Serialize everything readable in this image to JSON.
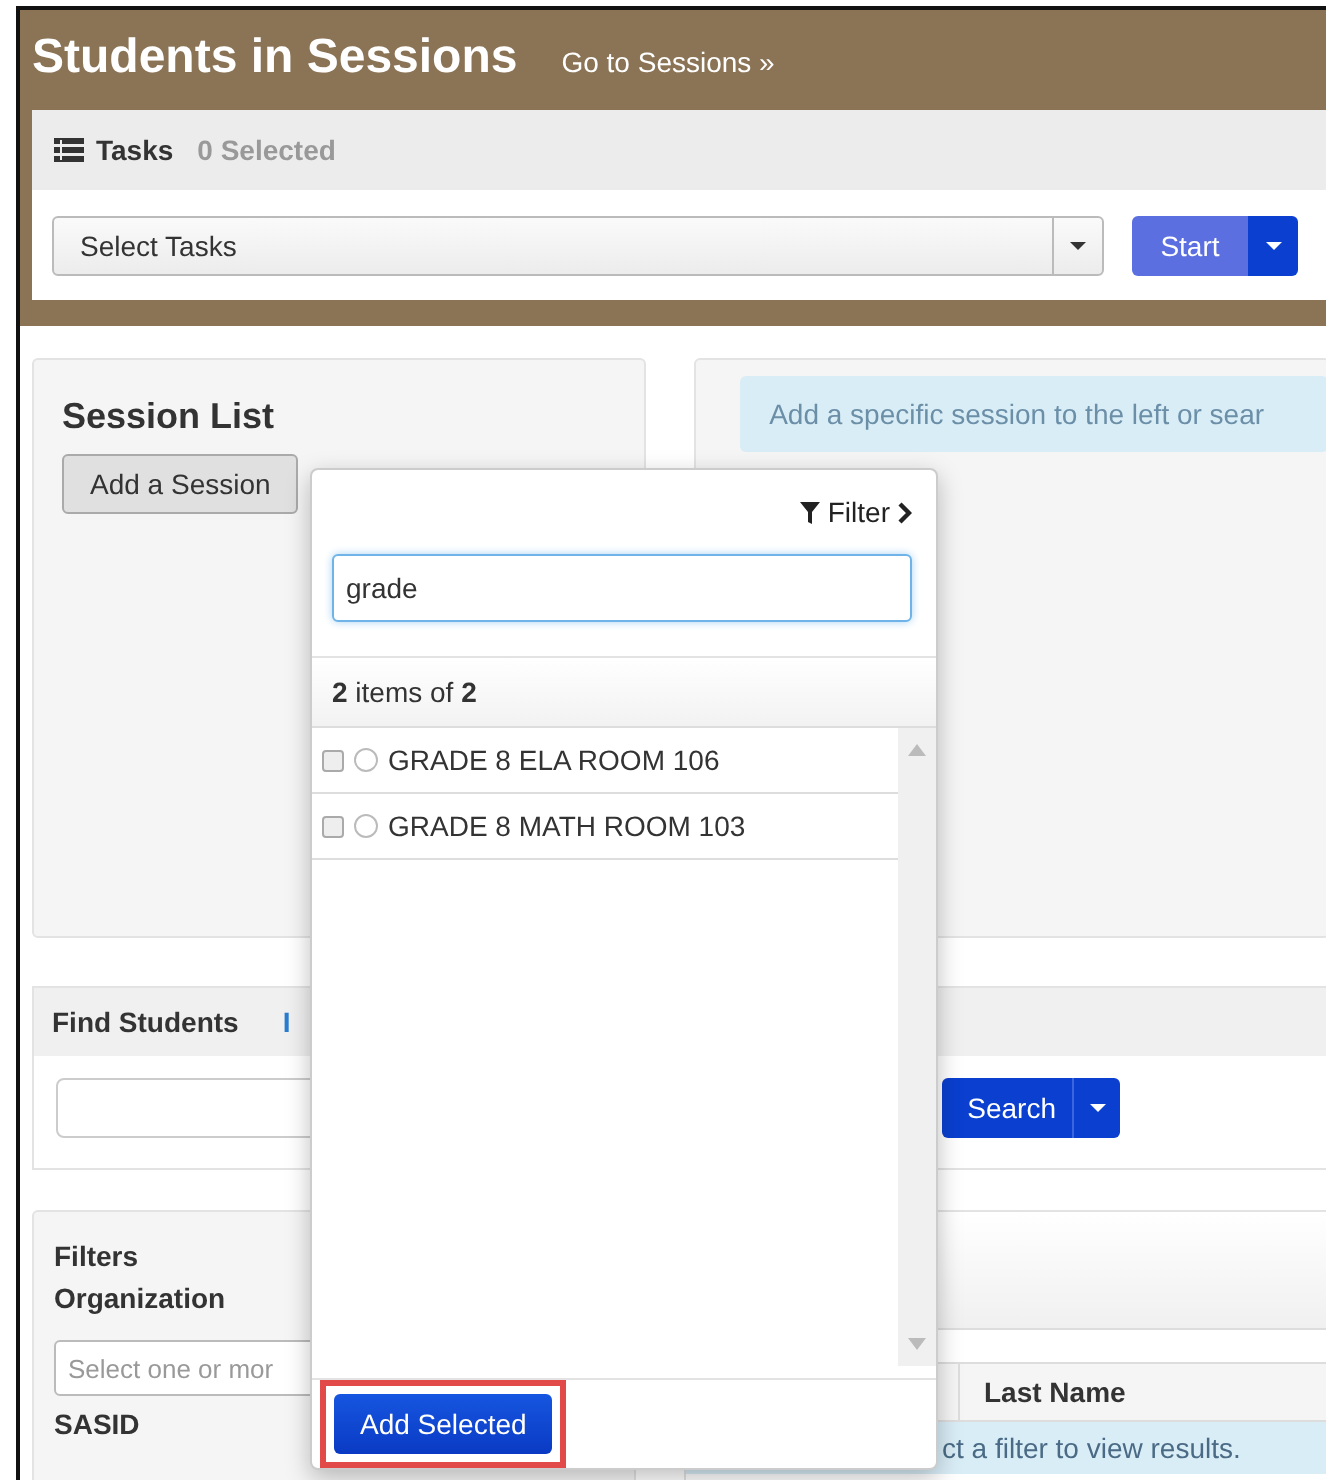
{
  "header": {
    "title": "Students in Sessions",
    "link": "Go to Sessions »"
  },
  "tasks": {
    "label": "Tasks",
    "count": "0 Selected",
    "select": "Select Tasks",
    "start_button": "Start"
  },
  "session_list": {
    "title": "Session List",
    "add_button": "Add a Session"
  },
  "session_info": "Add a specific session to the left or sear",
  "find_students": {
    "title": "Find Students",
    "link": "I",
    "search_button": "Search"
  },
  "filters": {
    "title": "Filters",
    "organization_label": "Organization",
    "organization_placeholder": "Select one or mor",
    "sasid_label": "SASID"
  },
  "results": {
    "columns": [
      "Last Name"
    ],
    "message": "ct a filter to view results."
  },
  "popup": {
    "filter_link": "Filter",
    "search": {
      "value": "grade"
    },
    "count": "**2** items of **2**",
    "items": [
      {
        "label": "GRADE 8 ELA ROOM 106",
        "checked": false,
        "selected": false
      },
      {
        "label": "GRADE 8 MATH ROOM 103",
        "checked": false,
        "selected": false
      }
    ],
    "add_button": "Add Selected",
    "highlighted": true
  }
}
